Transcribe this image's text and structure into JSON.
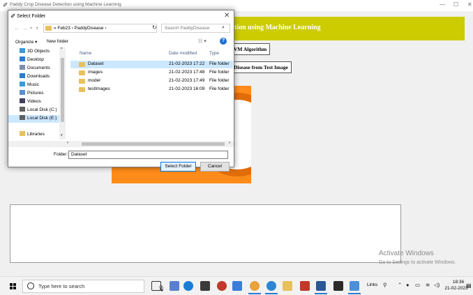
{
  "app": {
    "title": "Paddy Crop Disease Detection using Machine Learning",
    "header": "tion using Machine Learning",
    "button_svm": "VM Algorithm",
    "button_detect": "Disease from Test Image",
    "minimize": "—",
    "maximize": "☐",
    "close": "✕"
  },
  "dialog": {
    "title": "Select Folder",
    "address": "« Feb23 › PaddyDisease ›",
    "search_placeholder": "Search PaddyDisease",
    "organize": "Organize ▾",
    "new_folder": "New folder",
    "nav_items": [
      {
        "label": "3D Objects",
        "color": "#3a9ad9"
      },
      {
        "label": "Desktop",
        "color": "#2b7bd0"
      },
      {
        "label": "Documents",
        "color": "#7a8fb0"
      },
      {
        "label": "Downloads",
        "color": "#2b7bd0"
      },
      {
        "label": "Music",
        "color": "#3a9ad9"
      },
      {
        "label": "Pictures",
        "color": "#5a8fd0"
      },
      {
        "label": "Videos",
        "color": "#404060"
      },
      {
        "label": "Local Disk (C:)",
        "color": "#606060"
      },
      {
        "label": "Local Disk (E:)",
        "color": "#606060"
      },
      {
        "label": "Libraries",
        "color": "#e8c15c"
      }
    ],
    "columns": {
      "name": "Name",
      "date": "Date modified",
      "type": "Type"
    },
    "files": [
      {
        "name": "Dataset",
        "date": "21-02-2023 17:22",
        "type": "File folder"
      },
      {
        "name": "images",
        "date": "21-02-2023 17:48",
        "type": "File folder"
      },
      {
        "name": "model",
        "date": "21-02-2023 17:49",
        "type": "File folder"
      },
      {
        "name": "testImages",
        "date": "21-02-2023 16:09",
        "type": "File folder"
      }
    ],
    "folder_label": "Folder:",
    "folder_value": "Dataset",
    "select_button": "Select Folder",
    "cancel_button": "Cancel"
  },
  "watermark": {
    "title": "Activate Windows",
    "subtitle": "Go to Settings to activate Windows."
  },
  "taskbar": {
    "search_text": "Type here to search",
    "links": "Links",
    "clock_time": "18:36",
    "clock_date": "21-02-2023"
  }
}
